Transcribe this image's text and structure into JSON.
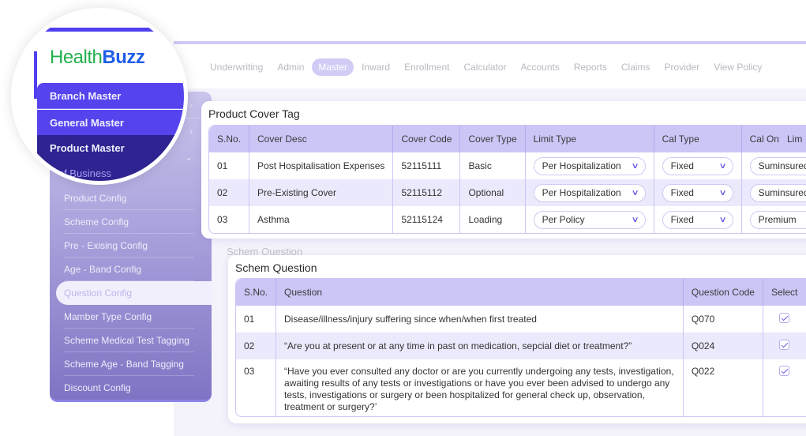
{
  "brand": {
    "part1": "Health",
    "part2": "Buzz",
    "color1": "#22b14c",
    "color2": "#1f5ee8"
  },
  "top_nav": {
    "items": [
      "Underwriting",
      "Admin",
      "Master",
      "Inward",
      "Enrollment",
      "Calculator",
      "Accounts",
      "Reports",
      "Claims",
      "Provider",
      "View Policy"
    ],
    "active": "Master"
  },
  "sidebar": {
    "main_items": [
      {
        "label": "Branch Master",
        "icon": "chevron-right-icon"
      },
      {
        "label": "General Master",
        "icon": "chevron-right-icon"
      },
      {
        "label": "Product Master",
        "icon": "chevron-down-icon",
        "expanded": true
      }
    ],
    "sub_items": [
      "Line of Business",
      "Product Config",
      "Scheme Config",
      "Pre - Exising Config",
      "Age - Band Config",
      "Question Config",
      "Mamber Type Config",
      "Scheme Medical Test Tagging",
      "Scheme Age - Band Tagging",
      "Discount Config"
    ],
    "active_sub_item": "Question Config",
    "partial_visible_lob": "e of Business"
  },
  "product_cover_tag": {
    "title": "Product Cover Tag",
    "columns": [
      "S.No.",
      "Cover Desc",
      "Cover Code",
      "Cover Type",
      "Limit Type",
      "Cal Type",
      "Cal On",
      "Lim"
    ],
    "rows": [
      {
        "sno": "01",
        "desc": "Post Hospitalisation Expenses",
        "code": "52115111",
        "type": "Basic",
        "limit_type": "Per Hospitalization",
        "cal_type": "Fixed",
        "cal_on": "Suminsured"
      },
      {
        "sno": "02",
        "desc": "Pre-Existing Cover",
        "code": "52115112",
        "type": "Optional",
        "limit_type": "Per Hospitalization",
        "cal_type": "Fixed",
        "cal_on": "Suminsured"
      },
      {
        "sno": "03",
        "desc": "Asthma",
        "code": "52115124",
        "type": "Loading",
        "limit_type": "Per Policy",
        "cal_type": "Fixed",
        "cal_on": "Premium"
      }
    ]
  },
  "schem_question": {
    "ghost_title": "Schem Question",
    "title": "Schem Question",
    "columns": [
      "S.No.",
      "Question",
      "Question Code",
      "Select"
    ],
    "rows": [
      {
        "sno": "01",
        "question": "Disease/illness/injury suffering since when/when first treated",
        "code": "Q070",
        "selected": true
      },
      {
        "sno": "02",
        "question": "“Are you at present or at any time in past on medication, sepcial diet or treatment?”",
        "code": "Q024",
        "selected": true
      },
      {
        "sno": "03",
        "question": "“Have you ever consulted any doctor or are you currently undergoing any tests, investigation, awaiting results of any tests or investigations or have you ever been advised to undergo any tests, investigations or surgery or been hospitalized for general check up, observation, treatment or surgery?’",
        "code": "Q022",
        "selected": true
      }
    ]
  },
  "colors": {
    "accent": "#5544ee",
    "accent_dark": "#2e2390",
    "table_header": "#cbc6f6",
    "row_alt": "#ebe9fc"
  }
}
